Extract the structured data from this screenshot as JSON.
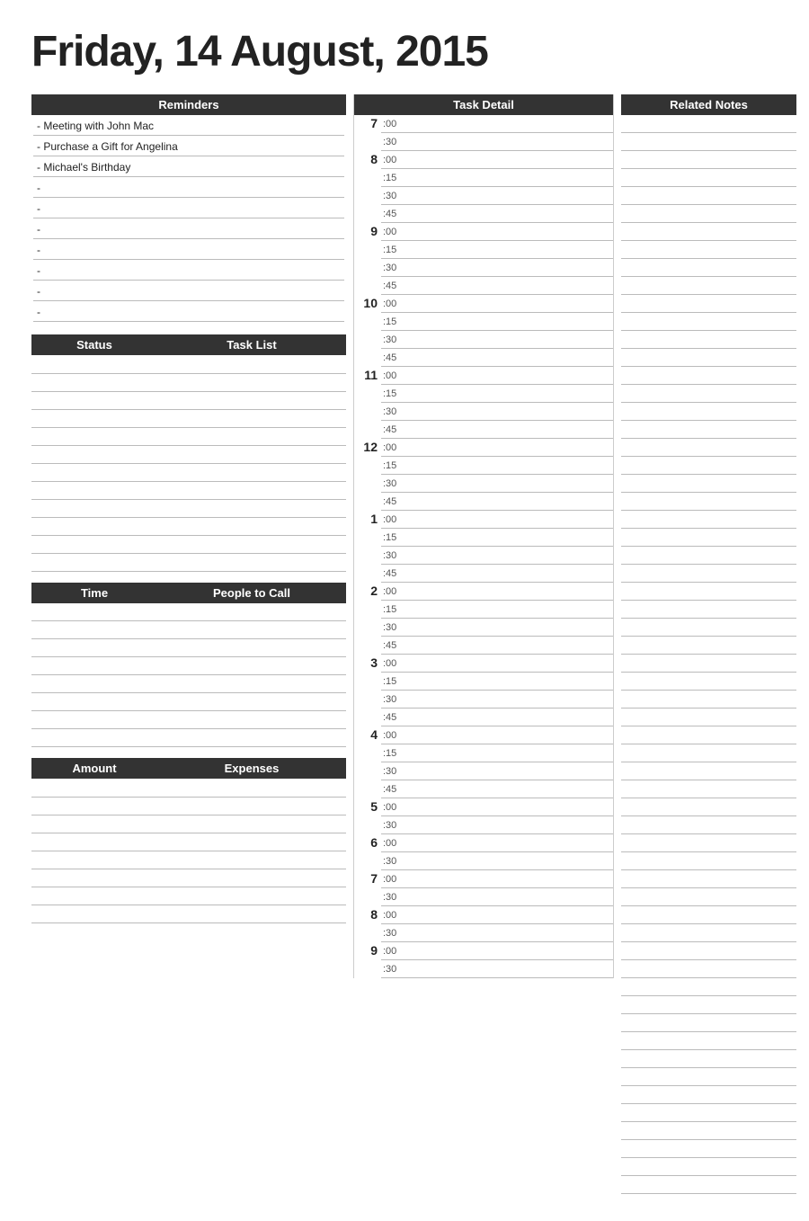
{
  "page": {
    "title": "Friday, 14 August, 2015"
  },
  "reminders": {
    "header": "Reminders",
    "items": [
      "- Meeting with John Mac",
      "- Purchase a Gift for Angelina",
      "- Michael's Birthday",
      "-",
      "-",
      "-",
      "-",
      "-",
      "-",
      "-"
    ]
  },
  "task_list": {
    "col1_header": "Status",
    "col2_header": "Task List",
    "rows": 12
  },
  "people_to_call": {
    "col1_header": "Time",
    "col2_header": "People to Call",
    "rows": 8
  },
  "expenses": {
    "col1_header": "Amount",
    "col2_header": "Expenses",
    "rows": 8
  },
  "task_detail": {
    "header": "Task Detail",
    "hours": [
      {
        "label": "7",
        "slots": [
          ":00",
          ":30"
        ]
      },
      {
        "label": "8",
        "slots": [
          ":00",
          ":15",
          ":30",
          ":45"
        ]
      },
      {
        "label": "9",
        "slots": [
          ":00",
          ":15",
          ":30",
          ":45"
        ]
      },
      {
        "label": "10",
        "slots": [
          ":00",
          ":15",
          ":30",
          ":45"
        ]
      },
      {
        "label": "11",
        "slots": [
          ":00",
          ":15",
          ":30",
          ":45"
        ]
      },
      {
        "label": "12",
        "slots": [
          ":00",
          ":15",
          ":30",
          ":45"
        ]
      },
      {
        "label": "1",
        "slots": [
          ":00",
          ":15",
          ":30",
          ":45"
        ]
      },
      {
        "label": "2",
        "slots": [
          ":00",
          ":15",
          ":30",
          ":45"
        ]
      },
      {
        "label": "3",
        "slots": [
          ":00",
          ":15",
          ":30",
          ":45"
        ]
      },
      {
        "label": "4",
        "slots": [
          ":00",
          ":15",
          ":30",
          ":45"
        ]
      },
      {
        "label": "5",
        "slots": [
          ":00",
          ":30"
        ]
      },
      {
        "label": "6",
        "slots": [
          ":00",
          ":30"
        ]
      },
      {
        "label": "7",
        "slots": [
          ":00",
          ":30"
        ]
      },
      {
        "label": "8",
        "slots": [
          ":00",
          ":30"
        ]
      },
      {
        "label": "9",
        "slots": [
          ":00",
          ":30"
        ]
      }
    ]
  },
  "related_notes": {
    "header": "Related Notes",
    "rows": 60
  }
}
